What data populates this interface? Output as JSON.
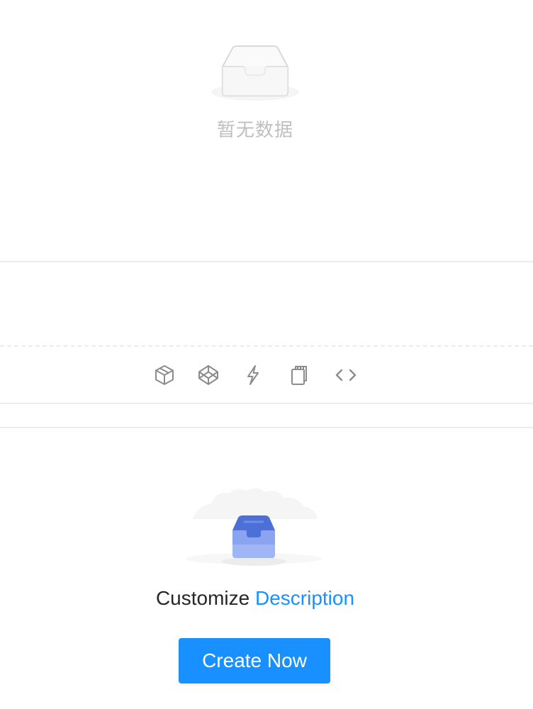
{
  "top_empty": {
    "description": "暂无数据",
    "icon": "inbox-empty-icon"
  },
  "actions": [
    {
      "name": "code-sandbox-icon",
      "label": "CodeSandbox"
    },
    {
      "name": "codepen-icon",
      "label": "CodePen"
    },
    {
      "name": "thunderbolt-icon",
      "label": "StackBlitz"
    },
    {
      "name": "copy-icon",
      "label": "Copy code"
    },
    {
      "name": "code-expand-icon",
      "label": "Show code"
    }
  ],
  "bottom_empty": {
    "description_prefix": "Customize",
    "description_link": "Description",
    "button_label": "Create Now",
    "illustration": "empty-box-illustration"
  },
  "colors": {
    "primary": "#1890ff",
    "muted_text": "#bfbfbf",
    "divider": "#ececec",
    "icon": "#8c8c8c"
  }
}
